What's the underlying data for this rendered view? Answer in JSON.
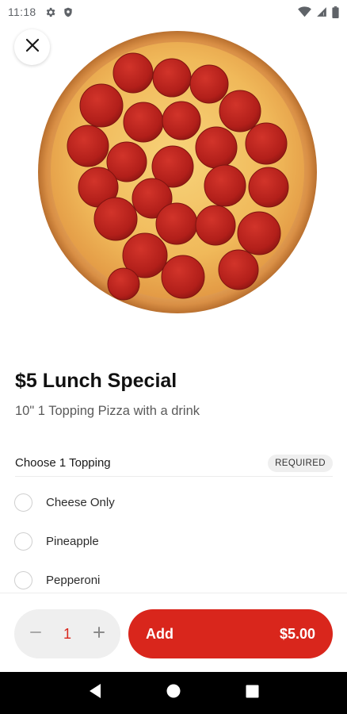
{
  "status_bar": {
    "time": "11:18",
    "left_icons": [
      "gear-icon",
      "shield-icon"
    ],
    "right_icons": [
      "wifi-icon",
      "cellular-signal-icon",
      "battery-icon"
    ]
  },
  "hero": {
    "image": "pepperoni-pizza",
    "close_icon": "close-icon"
  },
  "item": {
    "title": "$5 Lunch Special",
    "description": "10\" 1 Topping Pizza with a drink"
  },
  "option_group": {
    "title": "Choose 1 Topping",
    "badge": "REQUIRED",
    "options": [
      {
        "label": "Cheese Only",
        "selected": false
      },
      {
        "label": "Pineapple",
        "selected": false
      },
      {
        "label": "Pepperoni",
        "selected": false
      }
    ]
  },
  "cart": {
    "quantity": "1",
    "decrement_icon": "minus-icon",
    "increment_icon": "plus-icon",
    "add_label": "Add",
    "price": "$5.00"
  },
  "nav_bar": {
    "icons": [
      "back-icon",
      "home-icon",
      "recents-icon"
    ]
  },
  "colors": {
    "accent": "#d9261c",
    "stepper_bg": "#efefef",
    "badge_bg": "#efefef",
    "nav_bg": "#000000"
  }
}
